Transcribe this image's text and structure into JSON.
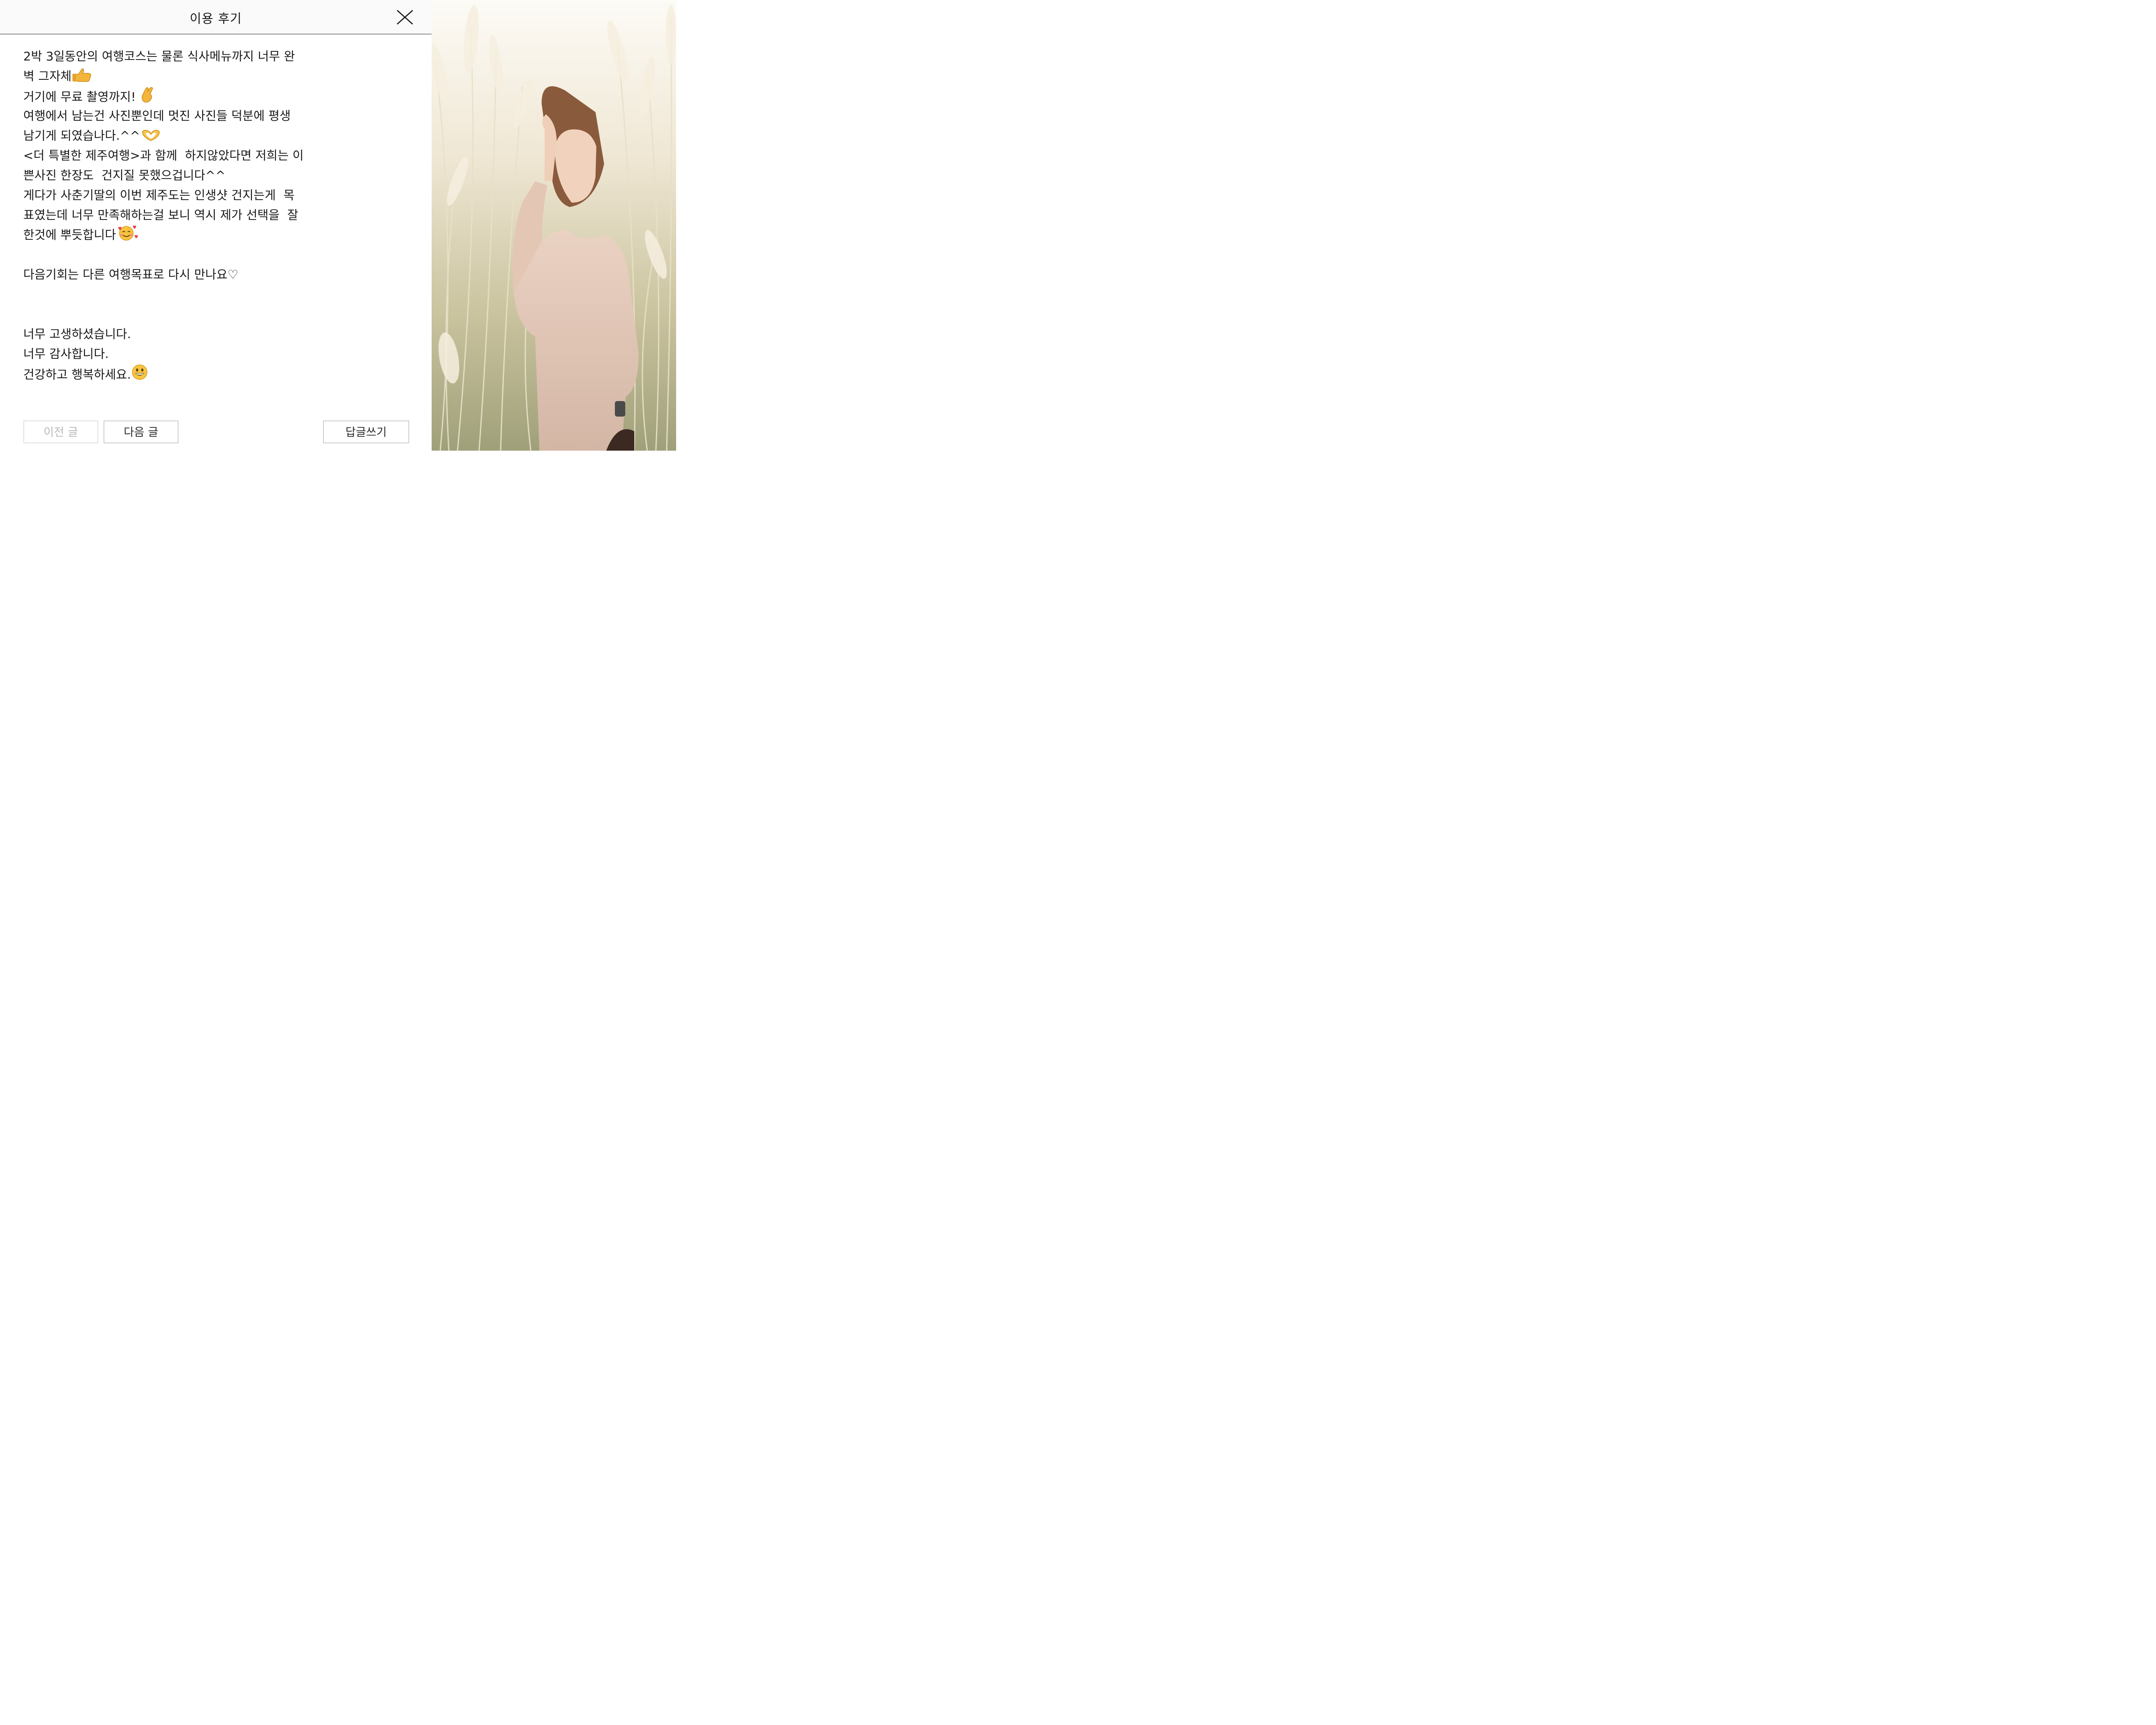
{
  "header": {
    "title": "이용 후기",
    "close_icon": "close-icon"
  },
  "review": {
    "lines": [
      "2박 3일동안의 여행코스는 물론 식사메뉴까지 너무 완",
      "벽 그자체",
      "거기에 무료 촬영까지! ",
      "여행에서 남는건 사진뿐인데 멋진 사진들 덕분에 평생",
      "남기게 되였습나다.^^",
      "<더 특별한 제주여행>과 함께  하지않았다면 저희는 이",
      "쁜사진 한장도  건지질 못했으겁니다^^",
      "게다가 사춘기딸의 이번 제주도는 인생샷 건지는게  목",
      "표였는데 너무 만족해하는걸 보니 역시 제가 선택을  잘",
      "한것에 뿌듯합니다",
      "",
      "다음기회는 다른 여행목표로 다시 만나요♡",
      "",
      "",
      "너무 고생하셨습니다.",
      "너무 감사합니다.",
      "건강하고 행복하세요."
    ],
    "emoji_icons": [
      "thumbs-up-icon",
      "crossed-fingers-icon",
      "heart-hands-icon",
      "smiling-face-with-hearts-icon",
      "grinning-face-icon"
    ]
  },
  "footer": {
    "prev_label": "이전 글",
    "next_label": "다음 글",
    "reply_label": "답글쓰기"
  },
  "colors": {
    "header_bg": "#fafafa",
    "divider": "#8f8f8f",
    "button_border": "#cfcfcf",
    "disabled_text": "#b9b9b9"
  }
}
